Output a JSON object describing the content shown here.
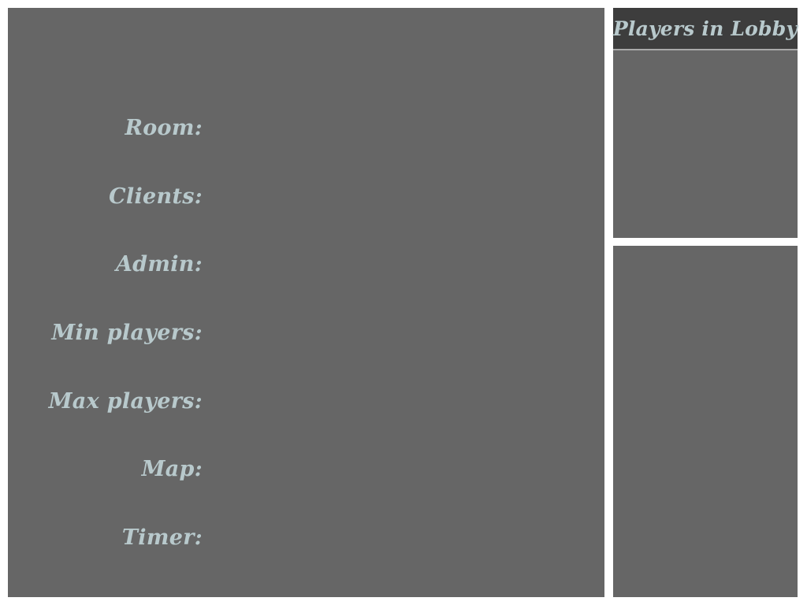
{
  "room_info": {
    "fields": [
      {
        "key": "room",
        "label": "Room:",
        "value": ""
      },
      {
        "key": "clients",
        "label": "Clients:",
        "value": ""
      },
      {
        "key": "admin",
        "label": "Admin:",
        "value": ""
      },
      {
        "key": "min_players",
        "label": "Min players:",
        "value": ""
      },
      {
        "key": "max_players",
        "label": "Max players:",
        "value": ""
      },
      {
        "key": "map",
        "label": "Map:",
        "value": ""
      },
      {
        "key": "timer",
        "label": "Timer:",
        "value": ""
      }
    ]
  },
  "players_panel": {
    "title": "Players in Lobby",
    "players": []
  },
  "colors": {
    "panel_background": "#666666",
    "header_background": "#3d3d3d",
    "text": "#b8c9cc",
    "page_background": "#ffffff"
  }
}
